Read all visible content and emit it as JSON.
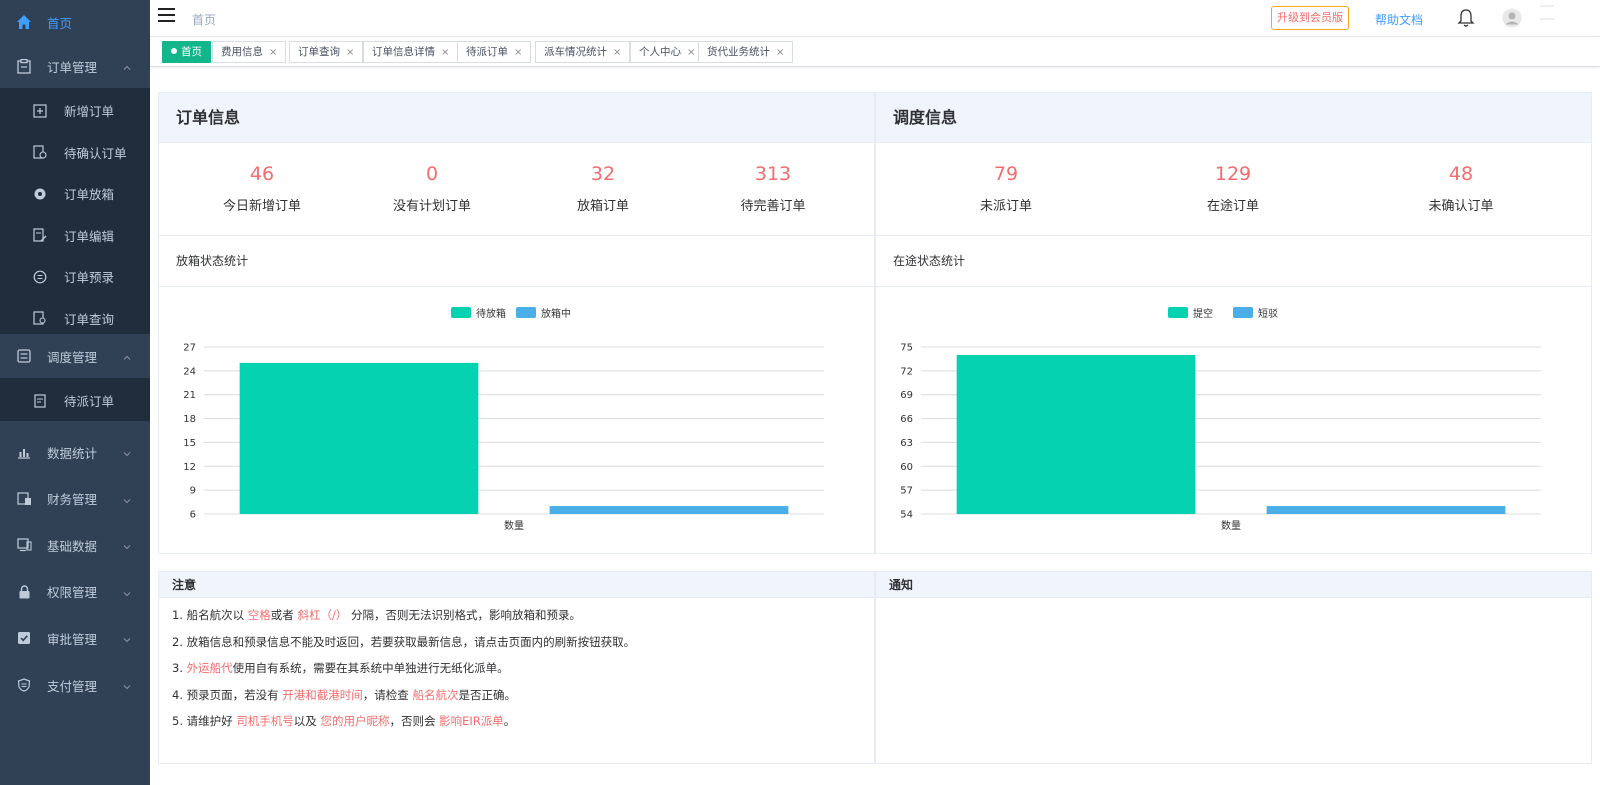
{
  "sidebar": {
    "home": "首页",
    "order_mgmt": "订单管理",
    "order_sub": [
      "新增订单",
      "待确认订单",
      "订单放箱",
      "订单编辑",
      "订单预录",
      "订单查询"
    ],
    "dispatch_mgmt": "调度管理",
    "dispatch_sub": [
      "待派订单"
    ],
    "groups": [
      "数据统计",
      "财务管理",
      "基础数据",
      "权限管理",
      "审批管理",
      "支付管理"
    ]
  },
  "navbar": {
    "breadcrumb": "首页",
    "upgrade": "升级到会员版",
    "help": "帮助文档"
  },
  "tags": [
    {
      "label": "首页",
      "active": true
    },
    {
      "label": "费用信息"
    },
    {
      "label": "订单查询"
    },
    {
      "label": "订单信息详情"
    },
    {
      "label": "待派订单"
    },
    {
      "label": "派车情况统计"
    },
    {
      "label": "个人中心"
    },
    {
      "label": "货代业务统计"
    }
  ],
  "tag_close": "×",
  "order_panel": {
    "title": "订单信息",
    "stats": [
      {
        "value": "46",
        "label": "今日新增订单"
      },
      {
        "value": "0",
        "label": "没有计划订单"
      },
      {
        "value": "32",
        "label": "放箱订单"
      },
      {
        "value": "313",
        "label": "待完善订单"
      }
    ],
    "chart_title": "放箱状态统计"
  },
  "dispatch_panel": {
    "title": "调度信息",
    "stats": [
      {
        "value": "79",
        "label": "未派订单"
      },
      {
        "value": "129",
        "label": "在途订单"
      },
      {
        "value": "48",
        "label": "未确认订单"
      }
    ],
    "chart_title": "在途状态统计"
  },
  "chart_data": [
    {
      "type": "bar",
      "categories": [
        "数量"
      ],
      "series": [
        {
          "name": "待放箱",
          "values": [
            25
          ]
        },
        {
          "name": "放箱中",
          "values": [
            7
          ]
        }
      ],
      "xlabel": "数量",
      "ylim": [
        6,
        27
      ],
      "yticks": [
        6,
        9,
        12,
        15,
        18,
        21,
        24,
        27
      ],
      "colors": [
        "#05d2b0",
        "#4aaee9"
      ],
      "legend": "top-center",
      "grid": true
    },
    {
      "type": "bar",
      "categories": [
        "数量"
      ],
      "series": [
        {
          "name": "提空",
          "values": [
            74
          ]
        },
        {
          "name": "短驳",
          "values": [
            55
          ]
        }
      ],
      "xlabel": "数量",
      "ylim": [
        54,
        75
      ],
      "yticks": [
        54,
        57,
        60,
        63,
        66,
        69,
        72,
        75
      ],
      "colors": [
        "#05d2b0",
        "#4aaee9"
      ],
      "legend": "top-center",
      "grid": true
    }
  ],
  "notice": {
    "title": "注意",
    "lines": [
      [
        {
          "t": "1. 船名航次以 "
        },
        {
          "t": "空格",
          "hl": true
        },
        {
          "t": "或者 "
        },
        {
          "t": "斜杠（/）",
          "hl": true
        },
        {
          "t": " 分隔，否则无法识别格式，影响放箱和预录。"
        }
      ],
      [
        {
          "t": "2. 放箱信息和预录信息不能及时返回，若要获取最新信息，请点击页面内的刷新按钮获取。"
        }
      ],
      [
        {
          "t": "3. "
        },
        {
          "t": "外运船代",
          "hl": true
        },
        {
          "t": "使用自有系统，需要在其系统中单独进行无纸化派单。"
        }
      ],
      [
        {
          "t": "4. 预录页面，若没有 "
        },
        {
          "t": "开港和截港时间",
          "hl": true
        },
        {
          "t": "，请检查 "
        },
        {
          "t": "船名航次",
          "hl": true
        },
        {
          "t": "是否正确。"
        }
      ],
      [
        {
          "t": "5. 请维护好 "
        },
        {
          "t": "司机手机号",
          "hl": true
        },
        {
          "t": "以及 "
        },
        {
          "t": "您的用户昵称",
          "hl": true
        },
        {
          "t": "，否则会 "
        },
        {
          "t": "影响EIR派单",
          "hl": true
        },
        {
          "t": "。"
        }
      ]
    ]
  },
  "notify": {
    "title": "通知"
  }
}
